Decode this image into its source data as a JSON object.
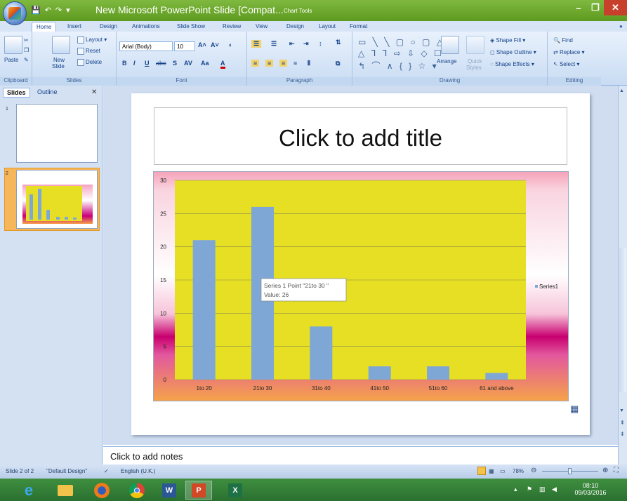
{
  "window": {
    "title": "New Microsoft PowerPoint Slide [Compat...",
    "context_tools": "Chart Tools"
  },
  "tabs": [
    "Home",
    "Insert",
    "Design",
    "Animations",
    "Slide Show",
    "Review",
    "View",
    "Design",
    "Layout",
    "Format"
  ],
  "ribbon": {
    "clipboard": {
      "paste": "Paste",
      "label": "Clipboard"
    },
    "slides": {
      "new_slide": "New",
      "new_slide2": "Slide",
      "layout": "Layout",
      "reset": "Reset",
      "delete": "Delete",
      "label": "Slides"
    },
    "font": {
      "family": "Arial (Body)",
      "size": "10",
      "label": "Font"
    },
    "paragraph": {
      "label": "Paragraph"
    },
    "drawing": {
      "arrange": "Arrange",
      "quick_styles": "Quick",
      "quick_styles2": "Styles",
      "shape_fill": "Shape Fill",
      "shape_outline": "Shape Outline",
      "shape_effects": "Shape Effects",
      "label": "Drawing"
    },
    "editing": {
      "find": "Find",
      "replace": "Replace",
      "select": "Select",
      "label": "Editing"
    }
  },
  "left_pane": {
    "tab_slides": "Slides",
    "tab_outline": "Outline",
    "close": "✕",
    "slide_numbers": [
      "1",
      "2"
    ]
  },
  "slide": {
    "title_placeholder": "Click to add title"
  },
  "notes": {
    "placeholder": "Click to add notes"
  },
  "chart_data": {
    "type": "bar",
    "categories": [
      "1to 20",
      "21to 30",
      "31to 40",
      "41to 50",
      "51to 60",
      "61 and above"
    ],
    "series": [
      {
        "name": "Series1",
        "values": [
          21,
          26,
          8,
          2,
          2,
          1
        ]
      }
    ],
    "ylim": [
      0,
      30
    ],
    "yticks": [
      "0",
      "5",
      "10",
      "15",
      "20",
      "25",
      "30"
    ],
    "grid": true,
    "legend": "right",
    "tooltip": {
      "line1": "Series 1 Point \"21to 30 \"",
      "line2": "Value: 26"
    },
    "colors": {
      "bar": "#7fa7d6",
      "plot": "#e6df23"
    }
  },
  "status": {
    "slide_info": "Slide 2 of 2",
    "theme": "\"Default Design\"",
    "language": "English (U.K.)",
    "zoom": "78%"
  },
  "taskbar": {
    "time": "08:10",
    "date": "09/03/2016"
  }
}
